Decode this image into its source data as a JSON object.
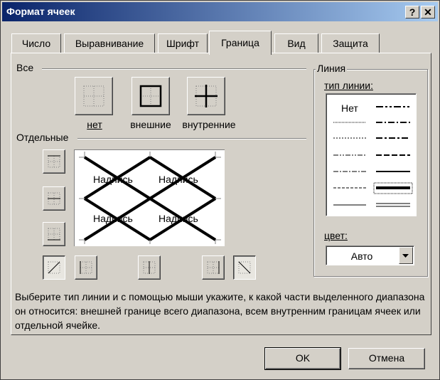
{
  "window": {
    "title": "Формат ячеек",
    "help_btn": "?",
    "close_btn": "✕"
  },
  "tabs": [
    {
      "label": "Число",
      "active": false
    },
    {
      "label": "Выравнивание",
      "active": false
    },
    {
      "label": "Шрифт",
      "active": false
    },
    {
      "label": "Граница",
      "active": true
    },
    {
      "label": "Вид",
      "active": false
    },
    {
      "label": "Защита",
      "active": false
    }
  ],
  "presets": {
    "group_label": "Все",
    "none_label": "нет",
    "outline_label": "внешние",
    "inside_label": "внутренние"
  },
  "border_group": {
    "label": "Отдельные"
  },
  "preview": {
    "cell_text": "Надпись"
  },
  "line": {
    "group_label": "Линия",
    "style_label": "тип линии:",
    "none_option": "Нет",
    "color_label": "цвет:",
    "color_value": "Авто"
  },
  "info_text": "Выберите тип линии и с помощью мыши укажите, к какой части выделенного диапазона он относится: внешней границе всего диапазона, всем внутренним границам ячеек или отдельной ячейке.",
  "buttons": {
    "ok": "OK",
    "cancel": "Отмена"
  }
}
